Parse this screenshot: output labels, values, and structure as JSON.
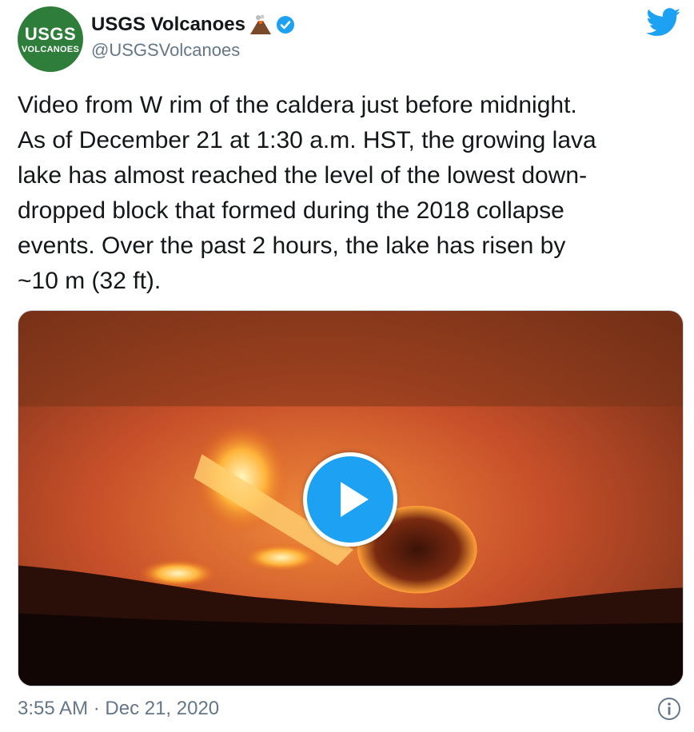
{
  "author": {
    "avatar_line1": "USGS",
    "avatar_line2": "VOLCANOES",
    "display_name": "USGS Volcanoes",
    "name_emoji": "volcano-icon",
    "verified": true,
    "handle": "@USGSVolcanoes"
  },
  "tweet": {
    "text": "Video from W rim of the caldera just before midnight.\nAs of December 21 at 1:30 a.m. HST, the growing lava\nlake has almost reached the level of the lowest down-\ndropped block that formed during the 2018 collapse\nevents. Over the past 2 hours, the lake has risen by\n~10 m (32 ft).",
    "media_type": "video",
    "timestamp": "3:55 AM · Dec 21, 2020"
  },
  "icons": {
    "brand": "twitter-bird-icon",
    "play": "play-icon",
    "info": "info-icon"
  },
  "colors": {
    "brand_blue": "#1da1f2",
    "text": "#14171a",
    "secondary": "#657786",
    "avatar_green": "#2e7d3a"
  }
}
